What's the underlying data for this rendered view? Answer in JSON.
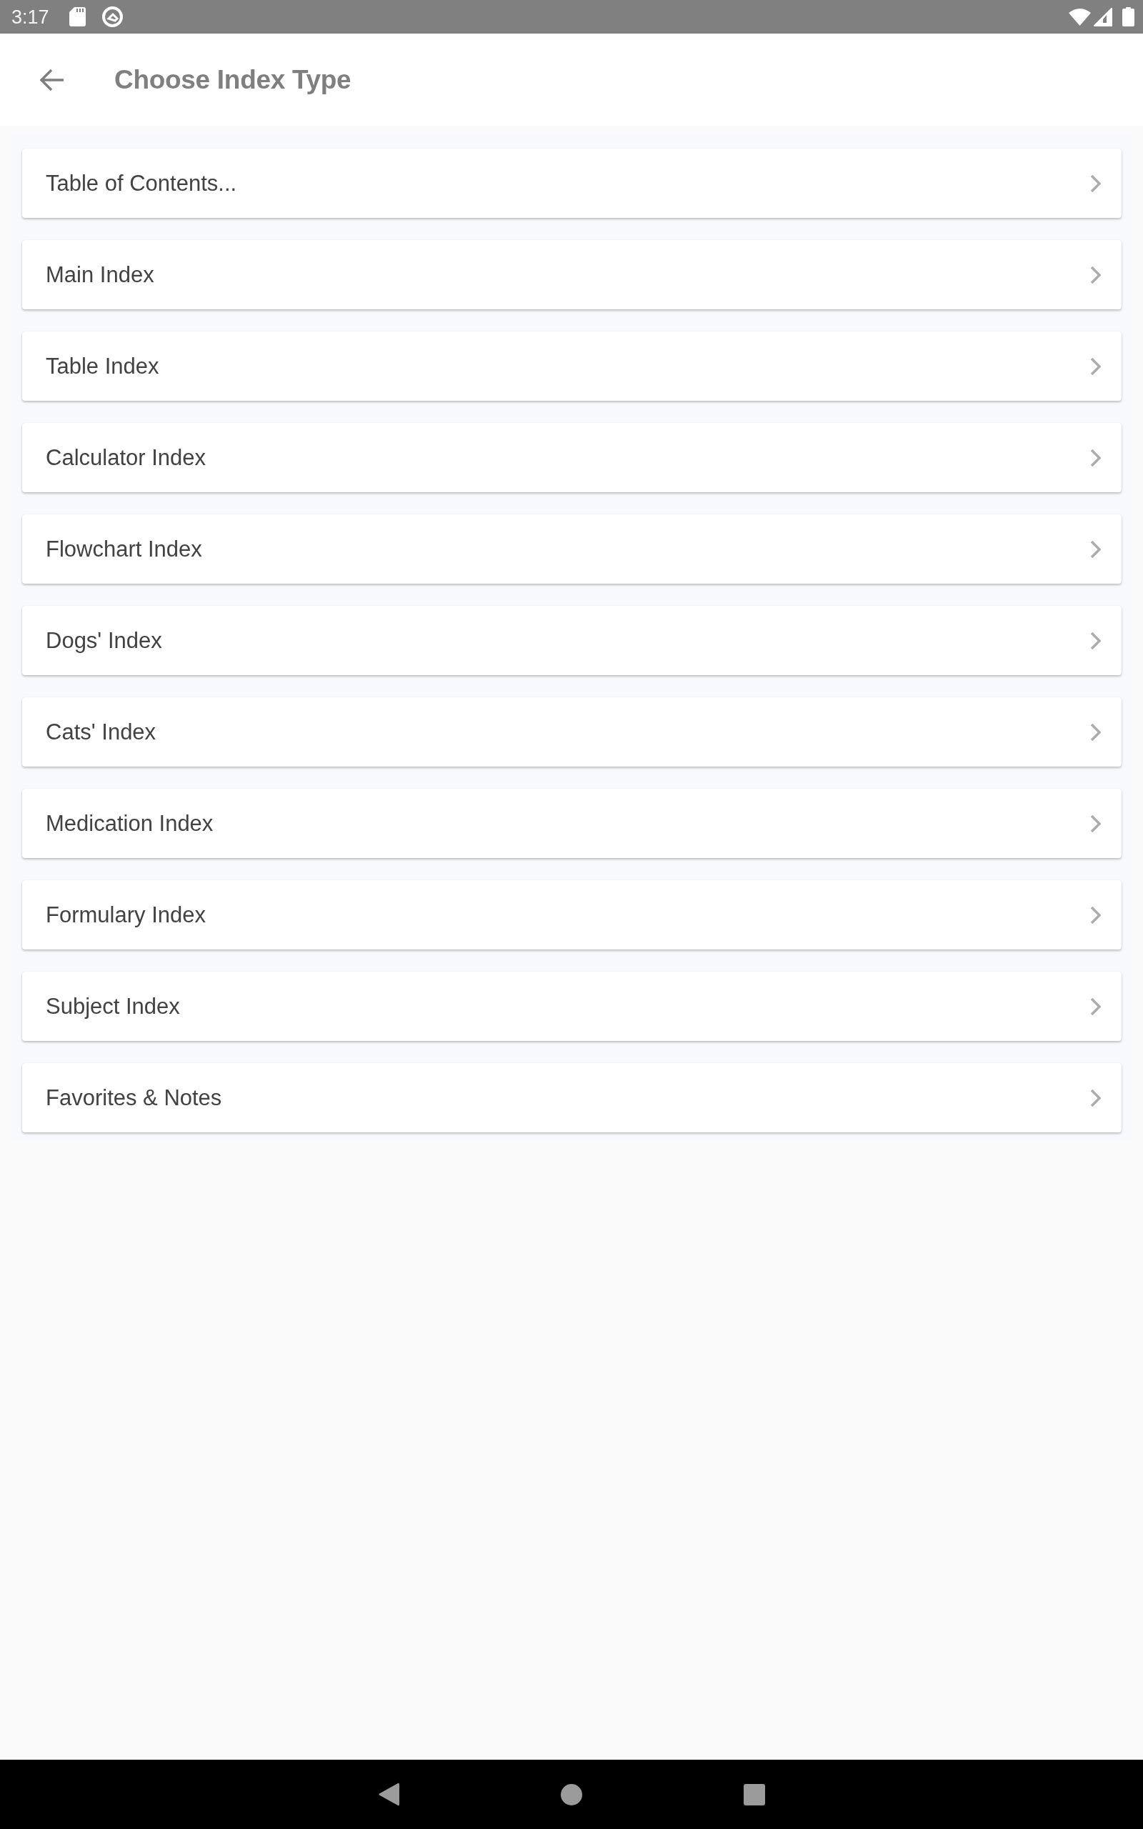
{
  "status_bar": {
    "time": "3:17"
  },
  "app_bar": {
    "title": "Choose Index Type"
  },
  "index_types": [
    {
      "label": "Table of Contents..."
    },
    {
      "label": "Main Index"
    },
    {
      "label": "Table Index"
    },
    {
      "label": "Calculator Index"
    },
    {
      "label": "Flowchart Index"
    },
    {
      "label": "Dogs' Index"
    },
    {
      "label": "Cats' Index"
    },
    {
      "label": "Medication Index"
    },
    {
      "label": "Formulary Index"
    },
    {
      "label": "Subject Index"
    },
    {
      "label": "Favorites & Notes"
    }
  ]
}
